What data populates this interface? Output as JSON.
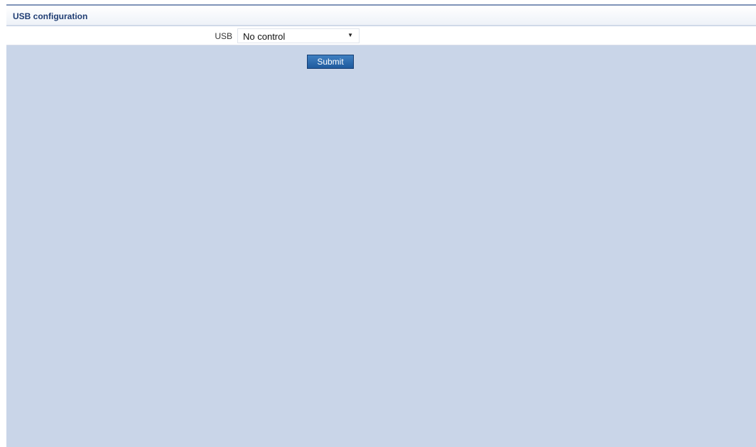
{
  "panel": {
    "title": "USB configuration"
  },
  "form": {
    "usb_label": "USB",
    "usb_value": "No control"
  },
  "actions": {
    "submit_label": "Submit"
  },
  "icons": {
    "dropdown": "chevron-down-icon"
  },
  "colors": {
    "panel_background": "#c9d5e8",
    "title_text": "#1f3d73",
    "submit_button": "#2a68ad"
  }
}
